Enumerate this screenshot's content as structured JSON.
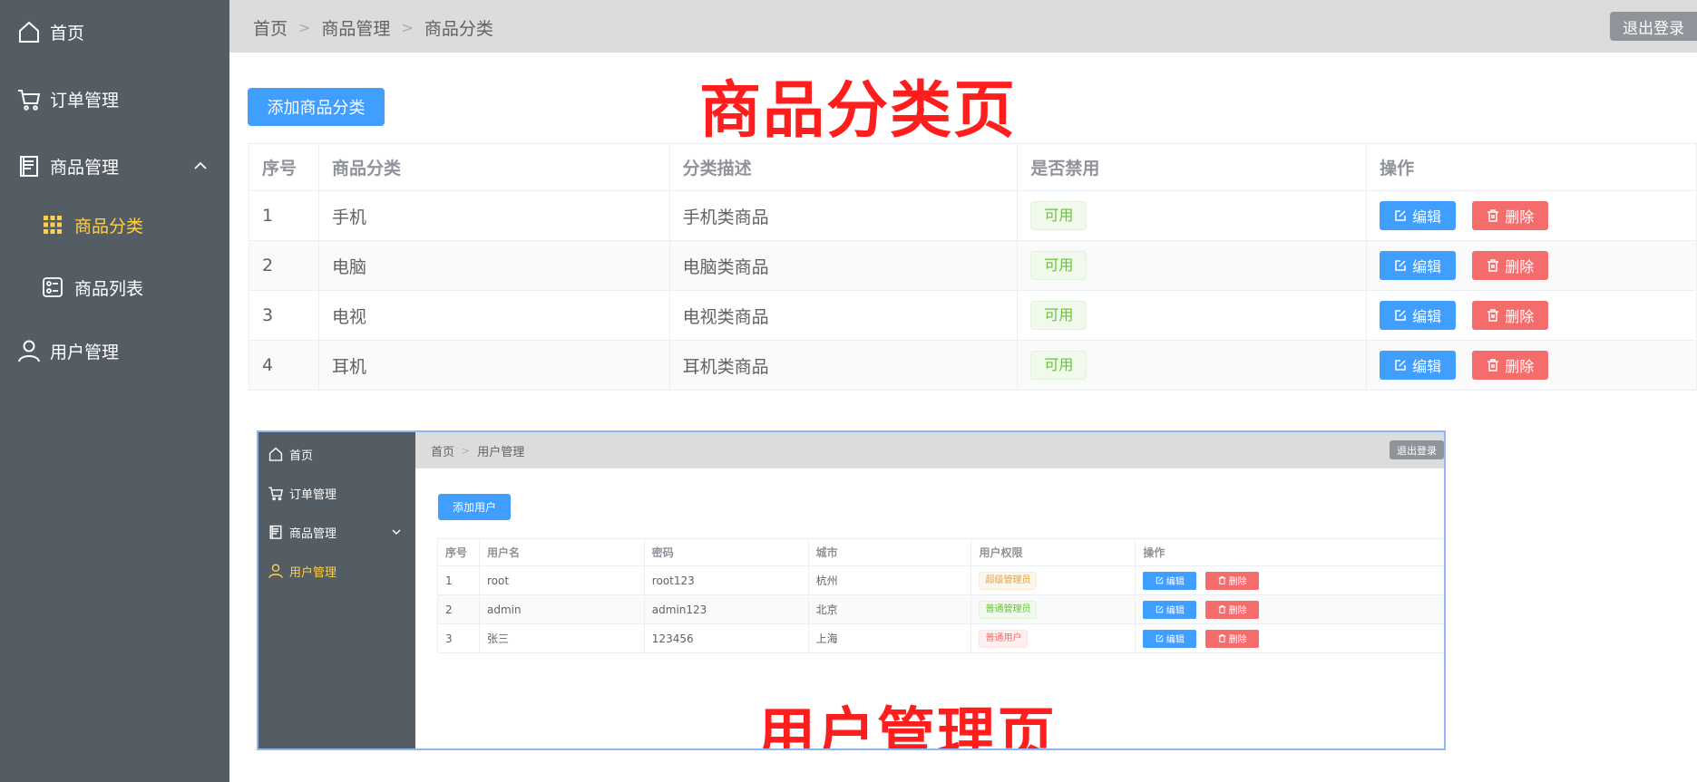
{
  "sidebar": {
    "items": [
      {
        "label": "首页",
        "icon": "home-icon"
      },
      {
        "label": "订单管理",
        "icon": "cart-icon"
      },
      {
        "label": "商品管理",
        "icon": "document-icon"
      },
      {
        "label": "商品分类",
        "icon": "grid-icon",
        "active": true
      },
      {
        "label": "商品列表",
        "icon": "list-icon"
      },
      {
        "label": "用户管理",
        "icon": "user-icon"
      }
    ]
  },
  "header": {
    "breadcrumb": [
      "首页",
      "商品管理",
      "商品分类"
    ],
    "logout_label": "退出登录"
  },
  "main": {
    "add_button_label": "添加商品分类",
    "overlay_title": "商品分类页",
    "table": {
      "columns": [
        "序号",
        "商品分类",
        "分类描述",
        "是否禁用",
        "操作"
      ],
      "rows": [
        {
          "index": "1",
          "name": "手机",
          "desc": "手机类商品",
          "status": "可用"
        },
        {
          "index": "2",
          "name": "电脑",
          "desc": "电脑类商品",
          "status": "可用"
        },
        {
          "index": "3",
          "name": "电视",
          "desc": "电视类商品",
          "status": "可用"
        },
        {
          "index": "4",
          "name": "耳机",
          "desc": "耳机类商品",
          "status": "可用"
        }
      ],
      "edit_label": "编辑",
      "delete_label": "删除"
    }
  },
  "screenshot": {
    "sidebar_items": [
      {
        "label": "首页",
        "icon": "home-icon"
      },
      {
        "label": "订单管理",
        "icon": "cart-icon"
      },
      {
        "label": "商品管理",
        "icon": "document-icon"
      },
      {
        "label": "用户管理",
        "icon": "user-icon",
        "active": true
      }
    ],
    "breadcrumb": [
      "首页",
      "用户管理"
    ],
    "logout_label": "退出登录",
    "add_button_label": "添加用户",
    "overlay_title": "用户管理页",
    "table": {
      "columns": [
        "序号",
        "用户名",
        "密码",
        "城市",
        "用户权限",
        "操作"
      ],
      "rows": [
        {
          "index": "1",
          "username": "root",
          "password": "root123",
          "city": "杭州",
          "role": "超级管理员",
          "role_type": "warning"
        },
        {
          "index": "2",
          "username": "admin",
          "password": "admin123",
          "city": "北京",
          "role": "普通管理员",
          "role_type": "success"
        },
        {
          "index": "3",
          "username": "张三",
          "password": "123456",
          "city": "上海",
          "role": "普通用户",
          "role_type": "danger"
        }
      ],
      "edit_label": "编辑",
      "delete_label": "删除"
    }
  },
  "colors": {
    "sidebar_bg": "#545c64",
    "active_text": "#ffd04b",
    "primary": "#409eff",
    "danger": "#f56c6c",
    "success": "#67c23a",
    "overlay_red": "#ff1e1e"
  }
}
